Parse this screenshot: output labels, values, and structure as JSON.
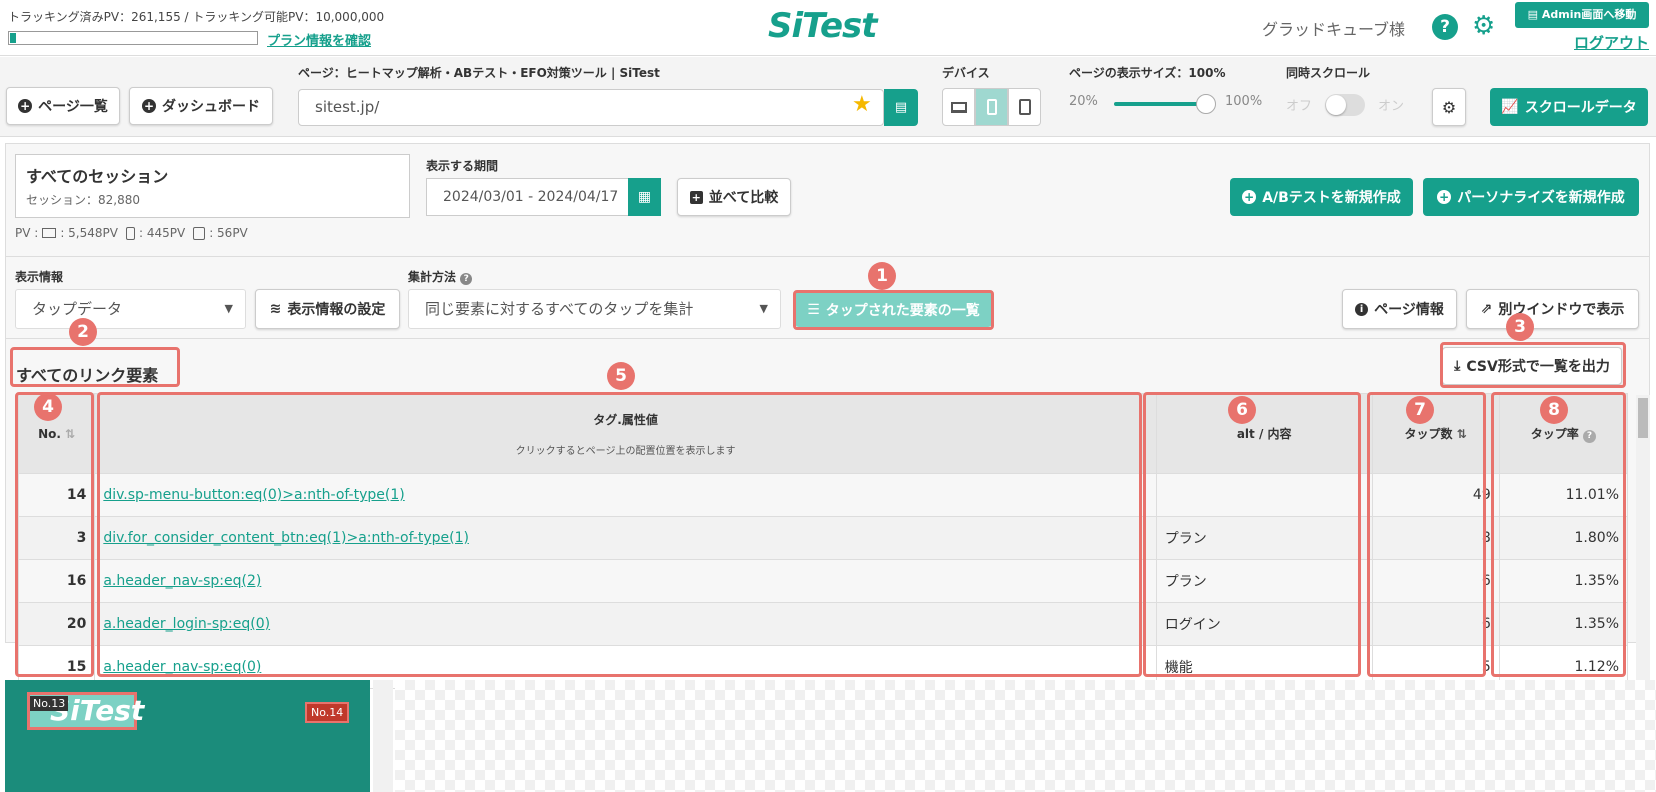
{
  "header": {
    "tracking_text": "トラッキング済みPV：261,155 / トラッキング可能PV：10,000,000",
    "tracking_progress": 0.026,
    "plan_link": "プラン情報を確認",
    "logo": "SiTest",
    "user_name": "グラッドキューブ様",
    "help_icon": "?",
    "admin_button": "Admin画面へ移動",
    "logout": "ログアウト"
  },
  "toolbar": {
    "page_list_btn": "ページ一覧",
    "dashboard_btn": "ダッシュボード",
    "page_label": "ページ：ヒートマップ解析・ABテスト・EFO対策ツール | SiTest",
    "url_value": "sitest.jp/",
    "device_label": "デバイス",
    "page_size_label": "ページの表示サイズ：100%",
    "size_min": "20%",
    "size_max": "100%",
    "sync_label": "同時スクロール",
    "sync_off": "オフ",
    "sync_on": "オン",
    "scroll_data_btn": "スクロールデータ"
  },
  "filters": {
    "session_title": "すべてのセッション",
    "session_count": "セッション：82,880",
    "pv_breakdown_prefix": "PV :",
    "pv_pc": ": 5,548PV",
    "pv_sp": ": 445PV",
    "pv_tab": ": 56PV",
    "period_label": "表示する期間",
    "period_value": "2024/03/01 - 2024/04/17",
    "compare_btn": "並べて比較",
    "ab_btn": "A/Bテストを新規作成",
    "personalize_btn": "パーソナライズを新規作成",
    "display_info_label": "表示情報",
    "display_info_value": "タップデータ",
    "display_settings_btn": "表示情報の設定",
    "aggregate_label": "集計方法",
    "aggregate_value": "同じ要素に対するすべてのタップを集計",
    "tapped_list_btn": "タップされた要素の一覧",
    "page_info_btn": "ページ情報",
    "new_window_btn": "別ウインドウで表示"
  },
  "table": {
    "title": "すべてのリンク要素",
    "csv_btn": "CSV形式で一覧を出力",
    "col_no": "No.",
    "col_tag": "タグ.属性値",
    "col_tag_sub": "クリックするとページ上の配置位置を表示します",
    "col_alt": "alt / 内容",
    "col_taps": "タップ数",
    "col_rate": "タップ率",
    "rows": [
      {
        "no": "14",
        "tag": "div.sp-menu-button:eq(0)>a:nth-of-type(1)",
        "alt": "",
        "taps": "49",
        "rate": "11.01%"
      },
      {
        "no": "3",
        "tag": "div.for_consider_content_btn:eq(1)>a:nth-of-type(1)",
        "alt": "プラン",
        "taps": "8",
        "rate": "1.80%"
      },
      {
        "no": "16",
        "tag": "a.header_nav-sp:eq(2)",
        "alt": "プラン",
        "taps": "6",
        "rate": "1.35%"
      },
      {
        "no": "20",
        "tag": "a.header_login-sp:eq(0)",
        "alt": "ログイン",
        "taps": "6",
        "rate": "1.35%"
      },
      {
        "no": "15",
        "tag": "a.header_nav-sp:eq(0)",
        "alt": "機能",
        "taps": "5",
        "rate": "1.12%"
      }
    ]
  },
  "annotations": [
    "1",
    "2",
    "3",
    "4",
    "5",
    "6",
    "7",
    "8"
  ],
  "preview": {
    "logo": "SiTest",
    "badge_13": "No.13",
    "badge_14": "No.14"
  }
}
